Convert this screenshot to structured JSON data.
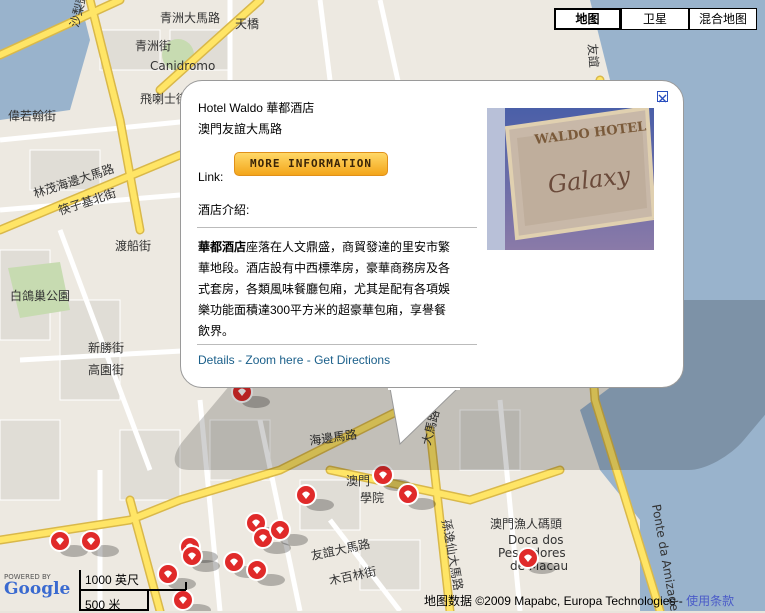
{
  "map_type_buttons": [
    "地图",
    "卫星",
    "混合地图"
  ],
  "active_map_type": "地图",
  "info_window": {
    "hotel_name": "Hotel Waldo 華都酒店",
    "address": "澳門友誼大馬路",
    "link_label": "Link:",
    "more_info_button": "MORE INFORMATION",
    "intro_label": "酒店介紹:",
    "description_bold": "華都酒店",
    "description_lines": [
      "座落在人文鼎盛，商貿發達的里安市繁",
      "華地段。酒店設有中西標準房，豪華商務房及各",
      "式套房，各類風味餐廳包廂，尤其是配有各項娛",
      "樂功能面積達300平方米的超豪華包廂，享譽餐",
      "飲界。"
    ],
    "footer_links": {
      "details": "Details",
      "zoom": "Zoom here",
      "directions": "Get Directions",
      "separator": " - "
    },
    "photo_sign_text": [
      "WALDO HOTEL",
      "Galaxy"
    ],
    "close_icon_glyph": "✕"
  },
  "map_labels": [
    "青洲大馬路",
    "青洲街",
    "沙梨頭北街",
    "Canidromo",
    "飛喇士街",
    "偉若翰街",
    "林茂海邊大馬路",
    "筷子基北街",
    "渡船街",
    "白鴿巢公園",
    "新勝街",
    "高園街",
    "海邊馬路",
    "澳門",
    "學院",
    "澳門漁人碼頭",
    "Doca dos",
    "Pescadores",
    "de Macau",
    "友誼大馬路",
    "木百林街",
    "孫逸仙大馬路",
    "Ponte da Amizade",
    "天橋",
    "友誼",
    "大馬路"
  ],
  "scale": {
    "top": "1000 英尺",
    "bottom": "500 米"
  },
  "google_logo": "Google",
  "powered_by": "POWERED BY",
  "copyright": {
    "text": "地图数据 ©2009 Mapabc, Europa Technologies - ",
    "terms": "使用条款"
  },
  "pin_count": 16,
  "colors": {
    "water": "#99b3cc",
    "road_major": "#ffe566",
    "road_outline": "#d9b84a",
    "pin": "#e02a2a",
    "link": "#1a5f8a"
  }
}
